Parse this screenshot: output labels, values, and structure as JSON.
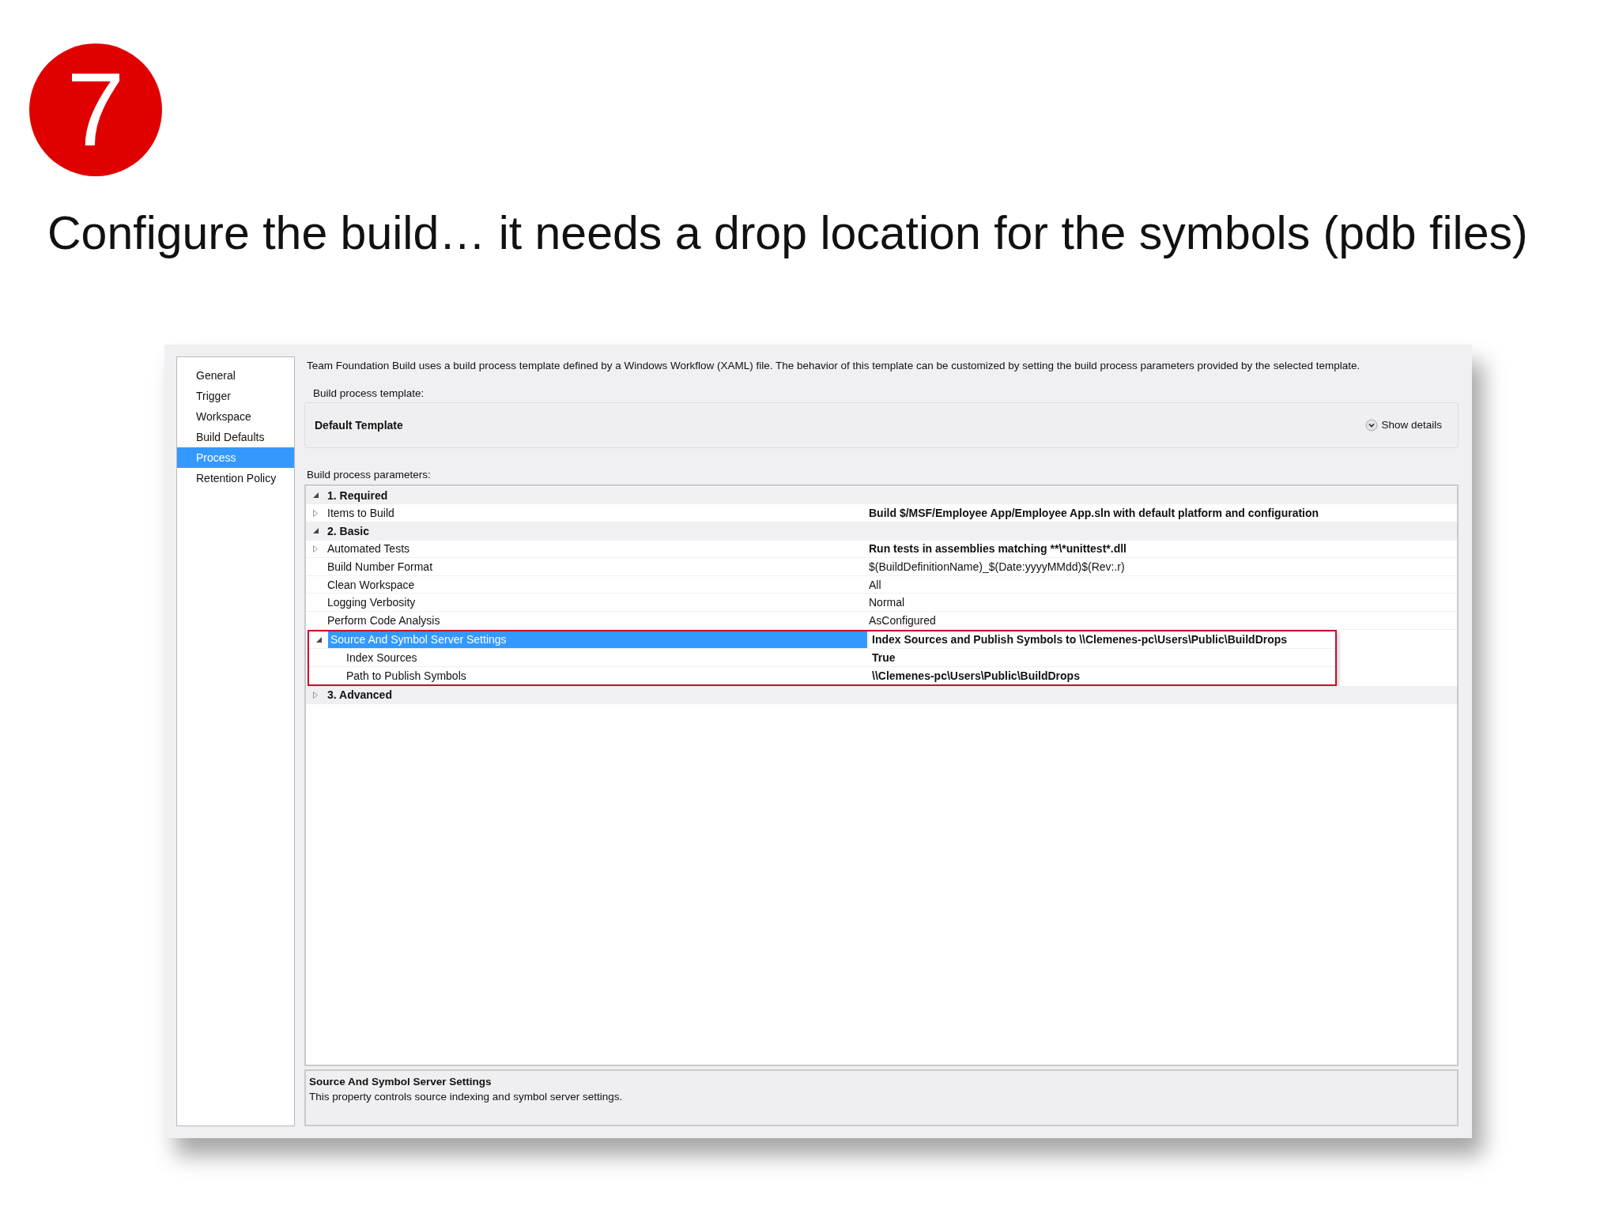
{
  "slide": {
    "step_number": "7",
    "title": "Configure the build… it needs a drop location for the symbols (pdb files)"
  },
  "sidebar": {
    "items": [
      {
        "label": "General",
        "selected": false
      },
      {
        "label": "Trigger",
        "selected": false
      },
      {
        "label": "Workspace",
        "selected": false
      },
      {
        "label": "Build Defaults",
        "selected": false
      },
      {
        "label": "Process",
        "selected": true
      },
      {
        "label": "Retention Policy",
        "selected": false
      }
    ]
  },
  "description": "Team Foundation Build uses a build process template defined by a Windows Workflow (XAML) file. The behavior of this template can be customized by setting the build process parameters provided by the selected template.",
  "template_group": {
    "label": "Build process template:",
    "value": "Default Template",
    "details_link": "Show details"
  },
  "parameters": {
    "label": "Build process parameters:",
    "rows": [
      {
        "kind": "category",
        "name": "1. Required",
        "expanded": true,
        "children": [
          {
            "kind": "property",
            "name": "Items to Build",
            "value": "Build $/MSF/Employee App/Employee App.sln with default platform and configuration",
            "modified": true,
            "expanded": false,
            "selected": false,
            "highlighted": false
          }
        ]
      },
      {
        "kind": "category",
        "name": "2. Basic",
        "expanded": true,
        "children": [
          {
            "kind": "property",
            "name": "Automated Tests",
            "value": "Run tests in assemblies matching **\\*unittest*.dll",
            "modified": true,
            "expanded": false,
            "selected": false,
            "highlighted": false
          },
          {
            "kind": "property",
            "name": "Build Number Format",
            "value": "$(BuildDefinitionName)_$(Date:yyyyMMdd)$(Rev:.r)",
            "modified": false,
            "selected": false,
            "highlighted": false
          },
          {
            "kind": "property",
            "name": "Clean Workspace",
            "value": "All",
            "modified": false,
            "selected": false,
            "highlighted": false
          },
          {
            "kind": "property",
            "name": "Logging Verbosity",
            "value": "Normal",
            "modified": false,
            "selected": false,
            "highlighted": false
          },
          {
            "kind": "property",
            "name": "Perform Code Analysis",
            "value": "AsConfigured",
            "modified": false,
            "selected": false,
            "highlighted": false
          },
          {
            "kind": "property",
            "name": "Source And Symbol Server Settings",
            "value": "Index Sources and Publish Symbols to \\\\Clemenes-pc\\Users\\Public\\BuildDrops",
            "modified": true,
            "expanded": true,
            "selected": true,
            "highlighted": true,
            "children": [
              {
                "kind": "property",
                "name": "Index Sources",
                "value": "True",
                "modified": true,
                "selected": false
              },
              {
                "kind": "property",
                "name": "Path to Publish Symbols",
                "value": "\\\\Clemenes-pc\\Users\\Public\\BuildDrops",
                "modified": true,
                "selected": false
              }
            ]
          }
        ]
      },
      {
        "kind": "category",
        "name": "3. Advanced",
        "expanded": false
      }
    ]
  },
  "help": {
    "title": "Source And Symbol Server Settings",
    "text": "This property controls source indexing and symbol server settings."
  }
}
